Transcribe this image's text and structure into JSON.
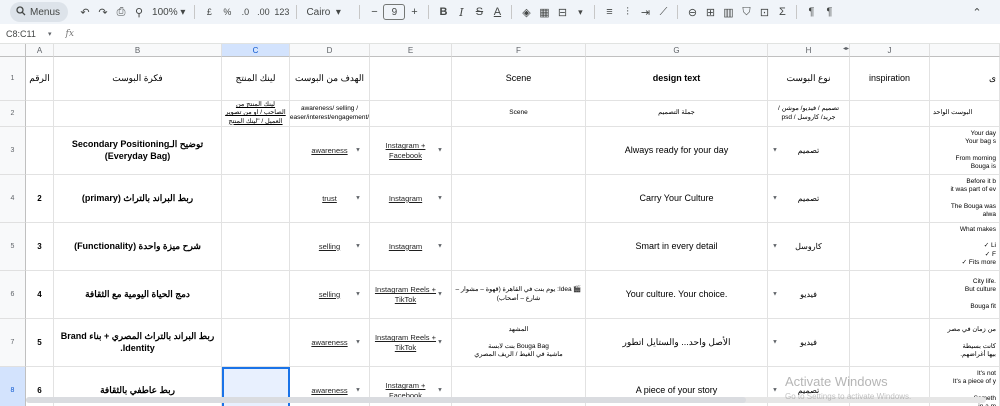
{
  "toolbar": {
    "menus_label": "Menus",
    "zoom": "100%",
    "currency": "£",
    "percent": "%",
    "dec_dec": ".0",
    "dec_inc": ".00",
    "num_format": "123",
    "font": "Cairo",
    "font_size": "9"
  },
  "formula_bar": {
    "name_box": "C8:C11",
    "fx": "fx"
  },
  "columns": [
    "A",
    "B",
    "C",
    "D",
    "E",
    "F",
    "G",
    "H",
    "J"
  ],
  "rows": [
    "1",
    "2",
    "3",
    "4",
    "5",
    "6",
    "7",
    "8"
  ],
  "header_row": {
    "a": "الرقم",
    "b": "فكرة البوست",
    "c": "لينك المنتج",
    "d": "الهدف من البوست",
    "e": "",
    "f": "Scene",
    "g": "design text",
    "h": "نوع البوست",
    "i": "inspiration",
    "j": "ى"
  },
  "desc_row": {
    "c": "لينك المنتج من الصاحب / او من تصوير العميل / \"لينك المنتج",
    "d": "awareness/ selling / teaser/interest/engagement/.",
    "f": "Scene",
    "g": "جملة التصميم",
    "h": "تصميم / فيديو/ موشن / جريد/ كاروسل / psd",
    "j": "البوست الواحد"
  },
  "data_rows": [
    {
      "num": "",
      "idea": "توضيح الـSecondary Positioning (Everyday Bag)",
      "goal": "awareness",
      "platform": "Instagram + Facebook",
      "scene": "",
      "design_text": "Always ready for your day",
      "type": "تصميم",
      "clip": "Your day\nYour bag s\n\nFrom morning\nBouga is"
    },
    {
      "num": "2",
      "idea": "ربط البراند بالتراث (primary)",
      "goal": "trust",
      "platform": "Instagram",
      "scene": "",
      "design_text": "Carry Your Culture",
      "type": "تصميم",
      "clip": "Before it b\nit was part of ev\n\nThe Bouga was\nalwa"
    },
    {
      "num": "3",
      "idea": "شرح ميزة واحدة (Functionality)",
      "goal": "selling",
      "platform": "Instagram",
      "scene": "",
      "design_text": "Smart in every detail",
      "type": "كاروسل",
      "clip": "What makes\n\n✓ Li\n✓ F\n✓ Fits more"
    },
    {
      "num": "4",
      "idea": "دمج الحياة اليومية مع الثقافة",
      "goal": "selling",
      "platform": "Instagram Reels + TikTok",
      "scene": "🎬 Idea: يوم بنت في القاهرة (قهوة – مشوار – شارع – أصحاب)",
      "design_text": "Your culture. Your choice.",
      "type": "فيديو",
      "clip": "City life.\nBut culture\n\nBouga fit"
    },
    {
      "num": "5",
      "idea": "ربط البراند بالتراث المصري + بناء Brand Identity.",
      "goal": "awareness",
      "platform": "Instagram Reels + TikTok",
      "scene": "المشهد\n\nBouga Bag بنت لابسة\nماشية في الغيط / الريف المصري",
      "design_text": "الأصل واحد... والستايل اتطور",
      "type": "فيديو",
      "clip": "من زمان في مصر\n\nكانت بسيطة\nبيها أغراضهم."
    },
    {
      "num": "6",
      "idea": "ربط عاطفي بالثقافة",
      "goal": "awareness",
      "platform": "Instagram + Facebook",
      "scene": "",
      "design_text": "A piece of your story",
      "type": "تصميم",
      "clip": "It's not\nIt's a piece of y\n\nSometh\nin a m"
    }
  ],
  "watermark": {
    "title": "Activate Windows",
    "subtitle": "Go to Settings to activate Windows."
  }
}
